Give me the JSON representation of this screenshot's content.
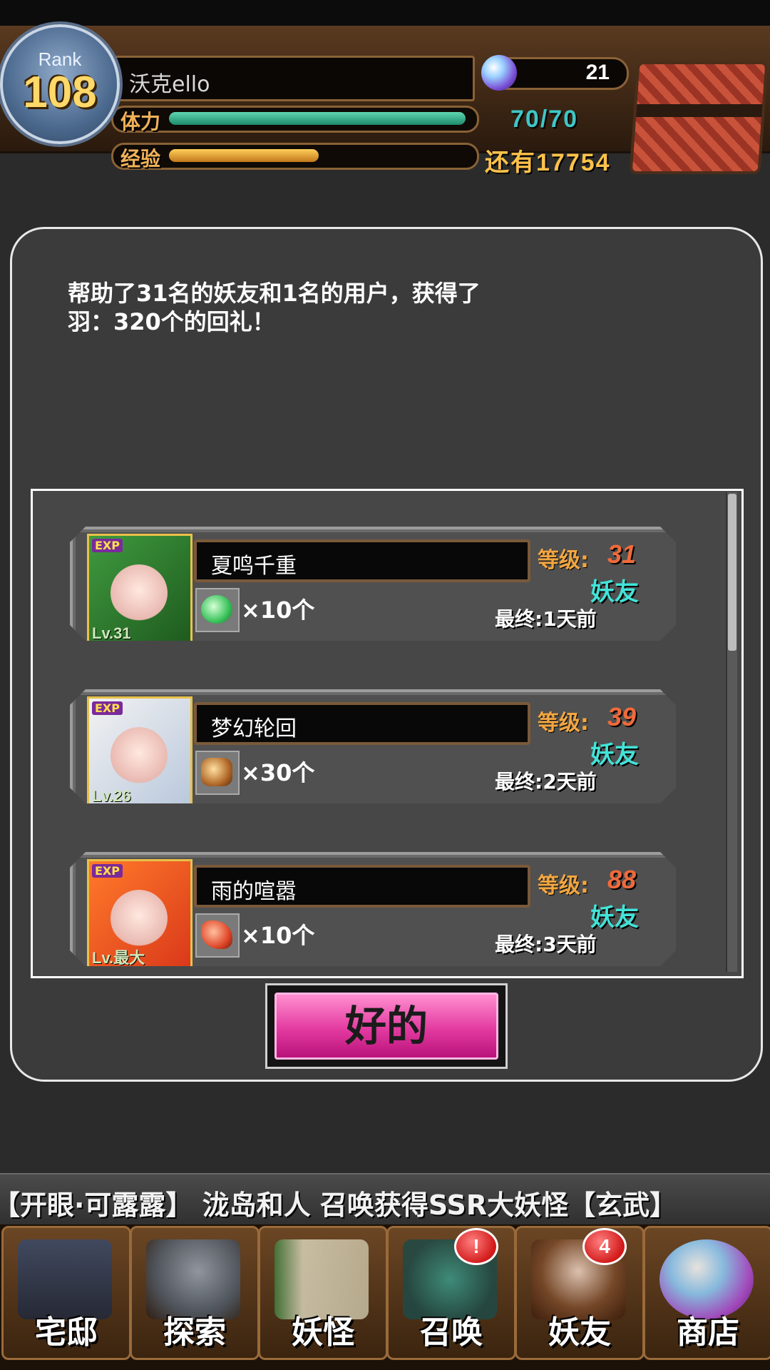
{
  "header": {
    "rank_label": "Rank",
    "rank_value": "108",
    "player_name": "沃克ello",
    "stamina_label": "体力",
    "stamina_fraction": 0.99,
    "stamina_text": "70/70",
    "exp_label": "经验",
    "exp_fraction": 0.5,
    "exp_remaining_text": "还有17754",
    "gem_count": "21",
    "gem_icon": "crystal-orb-icon",
    "chest_icon": "treasure-chest-icon"
  },
  "dialog": {
    "message": "帮助了31名的妖友和1名的用户，获得了\n羽：320个的回礼！",
    "ok_label": "好的",
    "friends": [
      {
        "name": "夏鸣千重",
        "avatar_level": "Lv.31",
        "item_icon": "green-orb-icon",
        "item_count": "×10个",
        "level_label": "等级:",
        "level_value": "31",
        "relation": "妖友",
        "last_login": "最终:1天前"
      },
      {
        "name": "梦幻轮回",
        "avatar_level": "Lv.26",
        "item_icon": "feather-brown-icon",
        "item_count": "×30个",
        "level_label": "等级:",
        "level_value": "39",
        "relation": "妖友",
        "last_login": "最终:2天前"
      },
      {
        "name": "雨的喧嚣",
        "avatar_level": "Lv.最大",
        "item_icon": "feather-red-icon",
        "item_count": "×10个",
        "level_label": "等级:",
        "level_value": "88",
        "relation": "妖友",
        "last_login": "最终:3天前"
      }
    ],
    "avatar_tag": "EXP"
  },
  "ticker": {
    "text": "【开眼·可露露】   泷岛和人 召唤获得SSR大妖怪【玄武】"
  },
  "nav": {
    "items": [
      {
        "label": "宅邸",
        "icon": "mansion-icon",
        "badge": ""
      },
      {
        "label": "探索",
        "icon": "magnifier-map-icon",
        "badge": ""
      },
      {
        "label": "妖怪",
        "icon": "scroll-monster-icon",
        "badge": ""
      },
      {
        "label": "召唤",
        "icon": "pentagram-icon",
        "badge": "!"
      },
      {
        "label": "妖友",
        "icon": "fox-girl-icon",
        "badge": "4"
      },
      {
        "label": "商店",
        "icon": "crystal-ball-icon",
        "badge": ""
      }
    ]
  },
  "colors": {
    "accent_pink": "#e33aa0",
    "level_orange": "#f06a3a",
    "relation_cyan": "#42e3d8"
  }
}
